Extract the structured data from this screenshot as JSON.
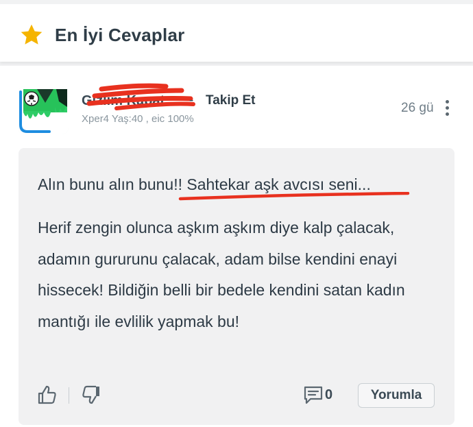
{
  "header": {
    "title": "En İyi Cevaplar",
    "icon": "star-icon",
    "star_color": "#f5b400"
  },
  "answer": {
    "author": {
      "name": "Gizlim Kapat",
      "name_redacted": true,
      "separator": "-",
      "follow_label": "Takip Et",
      "meta": "Xper4 Yaş:40 , eic 100%"
    },
    "time": "26 gü",
    "title": "Alın bunu alın bunu!! Sahtekar aşk avcısı seni...",
    "body": "Herif zengin olunca aşkım aşkım diye kalp çalacak, adamın gururunu çalacak, adam bilse kendini enayi hissecek! Bildiğin belli bir bedele kendini satan kadın mantığı ile evlilik yapmak bu!",
    "comment_count": "0",
    "reply_label": "Yorumla",
    "mark_color": "#e8311f"
  }
}
